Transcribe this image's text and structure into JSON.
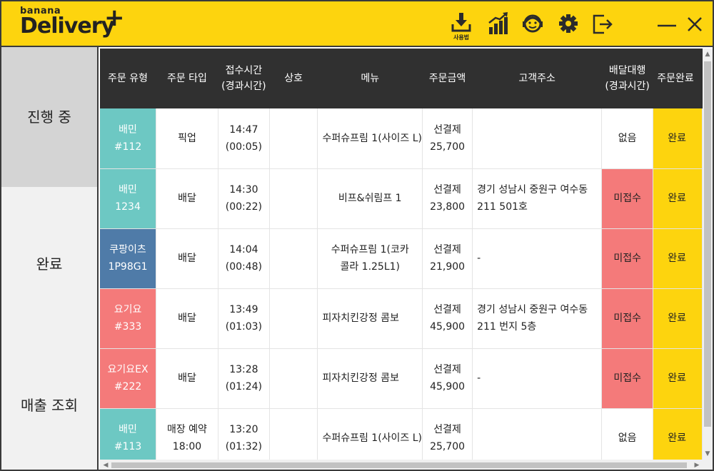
{
  "app": {
    "logo_small": "banana",
    "logo_big": "Delivery",
    "logo_plus": "+",
    "brand_color": "#fdd40e",
    "help_label": "사용법",
    "icons": [
      "download-icon",
      "statistics-icon",
      "support-headset-icon",
      "gear-icon",
      "logout-icon",
      "minimize-icon",
      "close-icon"
    ]
  },
  "sidebar": {
    "items": [
      {
        "label": "진행 중",
        "active": true
      },
      {
        "label": "완료",
        "active": false
      },
      {
        "label": "매출 조회",
        "active": false
      }
    ]
  },
  "table": {
    "headers": [
      {
        "line1": "주문 유형",
        "line2": ""
      },
      {
        "line1": "주문 타입",
        "line2": ""
      },
      {
        "line1": "접수시간",
        "line2": "(경과시간)"
      },
      {
        "line1": "상호",
        "line2": ""
      },
      {
        "line1": "메뉴",
        "line2": ""
      },
      {
        "line1": "주문금액",
        "line2": ""
      },
      {
        "line1": "고객주소",
        "line2": ""
      },
      {
        "line1": "배달대행",
        "line2": "(경과시간)"
      },
      {
        "line1": "주문완료",
        "line2": ""
      }
    ],
    "rows": [
      {
        "type1": "배민",
        "type2": "#112",
        "order_type1": "픽업",
        "order_type2": "",
        "time": "14:47",
        "elapsed": "(00:05)",
        "shop": "",
        "menu": "수퍼슈프림 1(사이즈 L)",
        "pay": "선결제",
        "amount": "25,700",
        "address": "",
        "delivery": "없음",
        "delivery_state": "none",
        "complete": "완료",
        "style": "baemin"
      },
      {
        "type1": "배민",
        "type2": "1234",
        "order_type1": "배달",
        "order_type2": "",
        "time": "14:30",
        "elapsed": "(00:22)",
        "shop": "",
        "menu": "비프&쉬림프 1",
        "pay": "선결제",
        "amount": "23,800",
        "address": "경기 성남시 중원구 여수동 211  501호",
        "delivery": "미접수",
        "delivery_state": "red",
        "complete": "완료",
        "style": "baemin"
      },
      {
        "type1": "쿠팡이츠",
        "type2": "1P98G1",
        "order_type1": "배달",
        "order_type2": "",
        "time": "14:04",
        "elapsed": "(00:48)",
        "shop": "",
        "menu": "수퍼슈프림 1(코카콜라 1.25L1)",
        "pay": "선결제",
        "amount": "21,900",
        "address": "-",
        "delivery": "미접수",
        "delivery_state": "red",
        "complete": "완료",
        "style": "coupang"
      },
      {
        "type1": "요기요",
        "type2": "#333",
        "order_type1": "배달",
        "order_type2": "",
        "time": "13:49",
        "elapsed": "(01:03)",
        "shop": "",
        "menu": "피자치킨강정 콤보",
        "pay": "선결제",
        "amount": "45,900",
        "address": "경기 성남시 중원구 여수동 211 번지 5층",
        "delivery": "미접수",
        "delivery_state": "red",
        "complete": "완료",
        "style": "yogiyo"
      },
      {
        "type1": "요기요EX",
        "type2": "#222",
        "order_type1": "배달",
        "order_type2": "",
        "time": "13:28",
        "elapsed": "(01:24)",
        "shop": "",
        "menu": "피자치킨강정 콤보",
        "pay": "선결제",
        "amount": "45,900",
        "address": "-",
        "delivery": "미접수",
        "delivery_state": "red",
        "complete": "완료",
        "style": "yogiyo"
      },
      {
        "type1": "배민",
        "type2": "#113",
        "order_type1": "매장 예약",
        "order_type2": "18:00",
        "time": "13:20",
        "elapsed": "(01:32)",
        "shop": "",
        "menu": "수퍼슈프림 1(사이즈 L)",
        "pay": "선결제",
        "amount": "25,700",
        "address": "",
        "delivery": "없음",
        "delivery_state": "none",
        "complete": "완료",
        "style": "baemin"
      }
    ]
  },
  "colors": {
    "baemin": "#6dc8c3",
    "coupang": "#4f7ba8",
    "yogiyo": "#f47a7a",
    "not_received": "#f47a7a",
    "complete": "#fdd40e",
    "header_bg": "#303030"
  }
}
